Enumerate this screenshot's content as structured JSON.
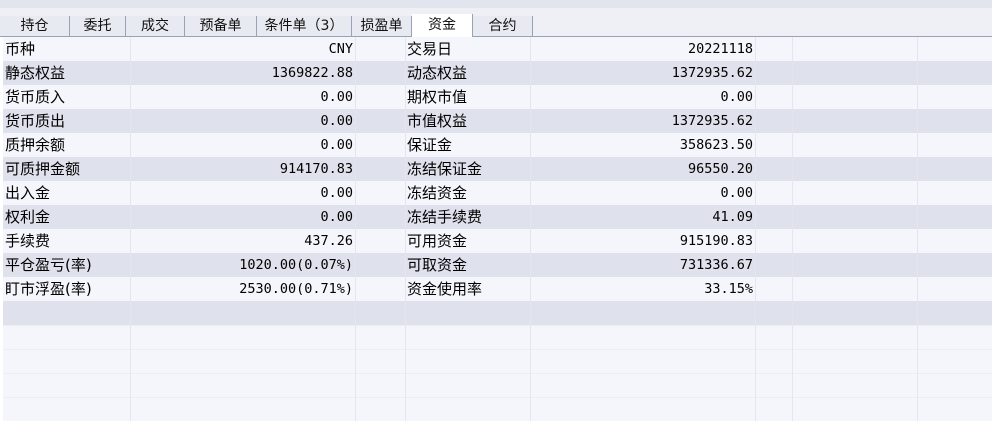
{
  "tabs": [
    {
      "label": "持仓"
    },
    {
      "label": "委托"
    },
    {
      "label": "成交"
    },
    {
      "label": "预备单"
    },
    {
      "label": "条件单（3）"
    },
    {
      "label": "损盈单"
    },
    {
      "label": "资金"
    },
    {
      "label": "合约"
    }
  ],
  "active_tab": "资金",
  "rows": [
    {
      "label1": "币种",
      "value1": "CNY",
      "label2": "交易日",
      "value2": "20221118"
    },
    {
      "label1": "静态权益",
      "value1": "1369822.88",
      "label2": "动态权益",
      "value2": "1372935.62"
    },
    {
      "label1": "货币质入",
      "value1": "0.00",
      "label2": "期权市值",
      "value2": "0.00"
    },
    {
      "label1": "货币质出",
      "value1": "0.00",
      "label2": "市值权益",
      "value2": "1372935.62"
    },
    {
      "label1": "质押余额",
      "value1": "0.00",
      "label2": "保证金",
      "value2": "358623.50"
    },
    {
      "label1": "可质押金额",
      "value1": "914170.83",
      "label2": "冻结保证金",
      "value2": "96550.20"
    },
    {
      "label1": "出入金",
      "value1": "0.00",
      "label2": "冻结资金",
      "value2": "0.00"
    },
    {
      "label1": "权利金",
      "value1": "0.00",
      "label2": "冻结手续费",
      "value2": "41.09"
    },
    {
      "label1": "手续费",
      "value1": "437.26",
      "label2": "可用资金",
      "value2": "915190.83"
    },
    {
      "label1": "平仓盈亏(率)",
      "value1": "1020.00(0.07%)",
      "label2": "可取资金",
      "value2": "731336.67"
    },
    {
      "label1": "盯市浮盈(率)",
      "value1": "2530.00(0.71%)",
      "label2": "资金使用率",
      "value2": "33.15%"
    }
  ]
}
